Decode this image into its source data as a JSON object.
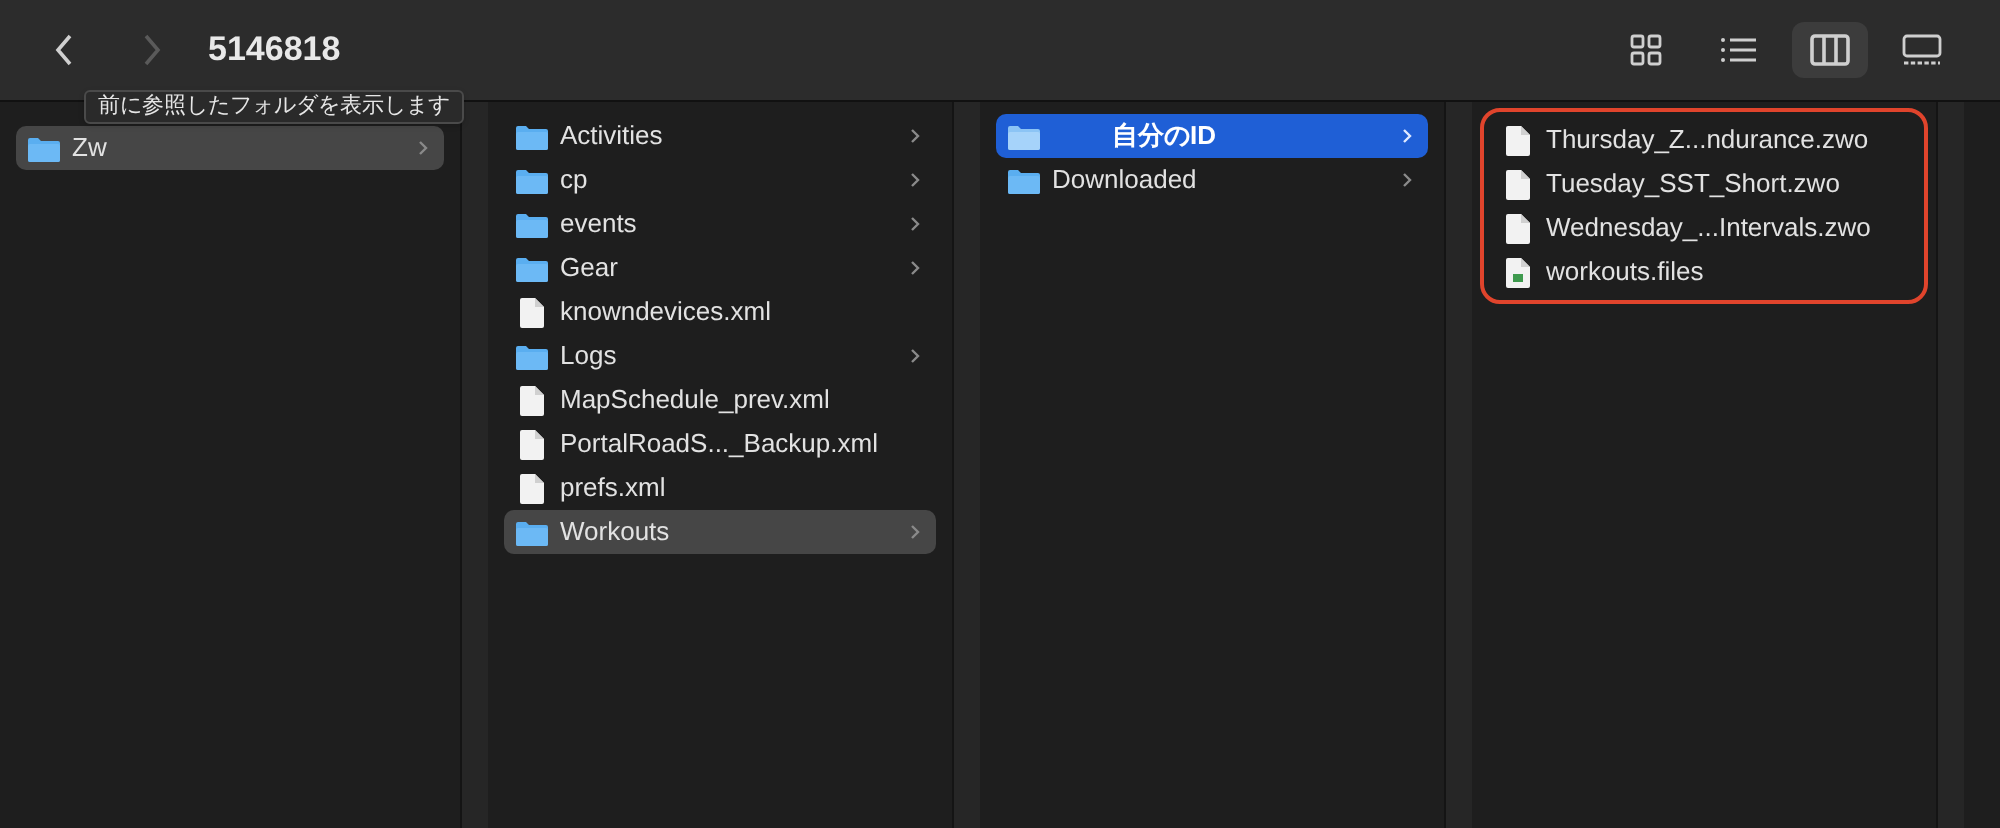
{
  "toolbar": {
    "back": {
      "disabled": false
    },
    "forward": {
      "disabled": true
    },
    "title": "5146818",
    "view_modes": [
      {
        "kind": "icons",
        "selected": false
      },
      {
        "kind": "list",
        "selected": false
      },
      {
        "kind": "columns",
        "selected": true
      },
      {
        "kind": "gallery",
        "selected": false
      }
    ]
  },
  "tooltip": "前に参照したフォルダを表示します",
  "columns": [
    {
      "active": false,
      "highlighted": false,
      "items": [
        {
          "name": "Zw",
          "kind": "folder",
          "selected": true
        }
      ]
    },
    {
      "active": false,
      "highlighted": false,
      "items": [
        {
          "name": "Activities",
          "kind": "folder",
          "selected": false
        },
        {
          "name": "cp",
          "kind": "folder",
          "selected": false
        },
        {
          "name": "events",
          "kind": "folder",
          "selected": false
        },
        {
          "name": "Gear",
          "kind": "folder",
          "selected": false
        },
        {
          "name": "knowndevices.xml",
          "kind": "document",
          "selected": false
        },
        {
          "name": "Logs",
          "kind": "folder",
          "selected": false
        },
        {
          "name": "MapSchedule_prev.xml",
          "kind": "document",
          "selected": false
        },
        {
          "name": "PortalRoadS..._Backup.xml",
          "kind": "document",
          "selected": false
        },
        {
          "name": "prefs.xml",
          "kind": "document",
          "selected": false
        },
        {
          "name": "Workouts",
          "kind": "folder",
          "selected": true
        }
      ]
    },
    {
      "active": true,
      "highlighted": false,
      "items": [
        {
          "name": "自分のID",
          "kind": "folder",
          "selected": true
        },
        {
          "name": "Downloaded",
          "kind": "folder",
          "selected": false
        }
      ]
    },
    {
      "highlighted": true,
      "items": [
        {
          "name": "Thursday_Z...ndurance.zwo",
          "kind": "document",
          "selected": false
        },
        {
          "name": "Tuesday_SST_Short.zwo",
          "kind": "document",
          "selected": false
        },
        {
          "name": "Wednesday_...Intervals.zwo",
          "kind": "document",
          "selected": false
        },
        {
          "name": "workouts.files",
          "kind": "data",
          "selected": false
        }
      ]
    }
  ]
}
